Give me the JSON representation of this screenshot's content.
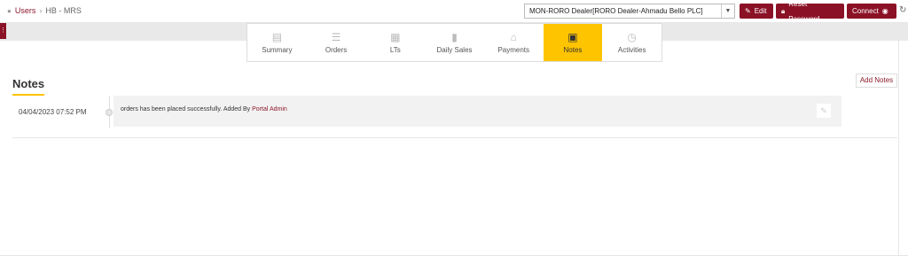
{
  "breadcrumb": {
    "root": "Users",
    "separator": "›",
    "current": "HB - MRS"
  },
  "dealer_select": {
    "value": "MON-RORO Dealer[RORO Dealer-Ahmadu Bello PLC]"
  },
  "actions": {
    "edit": "Edit",
    "reset_password": "Reset Password",
    "connect": "Connect"
  },
  "tabs": [
    {
      "label": "Summary",
      "icon": "summary-icon",
      "glyph": "▤",
      "active": false
    },
    {
      "label": "Orders",
      "icon": "orders-icon",
      "glyph": "☰",
      "active": false
    },
    {
      "label": "LTs",
      "icon": "lts-icon",
      "glyph": "▦",
      "active": false
    },
    {
      "label": "Daily Sales",
      "icon": "daily-sales-icon",
      "glyph": "▮",
      "active": false
    },
    {
      "label": "Payments",
      "icon": "payments-icon",
      "glyph": "⌂",
      "active": false
    },
    {
      "label": "Notes",
      "icon": "notes-icon",
      "glyph": "▣",
      "active": true
    },
    {
      "label": "Activities",
      "icon": "activities-icon",
      "glyph": "◷",
      "active": false
    }
  ],
  "notes": {
    "title": "Notes",
    "add_label": "Add Notes",
    "items": [
      {
        "date": "04/04/2023 07:52 PM",
        "text": "orders has been placed successfully. Added By",
        "author": "Portal Admin"
      }
    ]
  },
  "colors": {
    "brand": "#8b1226",
    "accent": "#ffc400"
  }
}
